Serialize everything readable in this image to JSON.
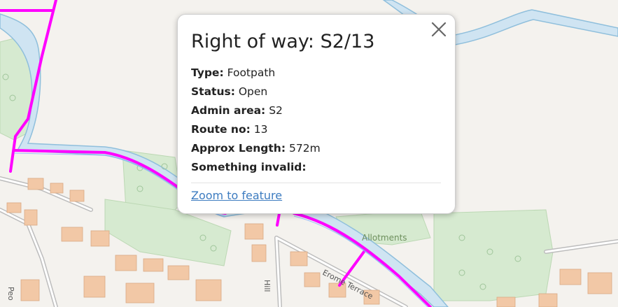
{
  "map": {
    "labels": {
      "allotments": "Allotments",
      "street_erome": "Erome Terrace",
      "street_a": "Hill",
      "street_b": "Peo"
    },
    "colors": {
      "background": "#f4f2ee",
      "water": "#cfe4f2",
      "water_edge": "#8fbfdc",
      "park": "#d6ead0",
      "building": "#f2c8a6",
      "right_of_way": "#ff00ff"
    }
  },
  "popup": {
    "title": "Right of way: S2/13",
    "close_icon": "close-icon",
    "fields": [
      {
        "label": "Type:",
        "value": "Footpath"
      },
      {
        "label": "Status:",
        "value": "Open"
      },
      {
        "label": "Admin area:",
        "value": "S2"
      },
      {
        "label": "Route no:",
        "value": "13"
      },
      {
        "label": "Approx Length:",
        "value": "572m"
      },
      {
        "label": "Something invalid:",
        "value": ""
      }
    ],
    "zoom_link": "Zoom to feature"
  }
}
